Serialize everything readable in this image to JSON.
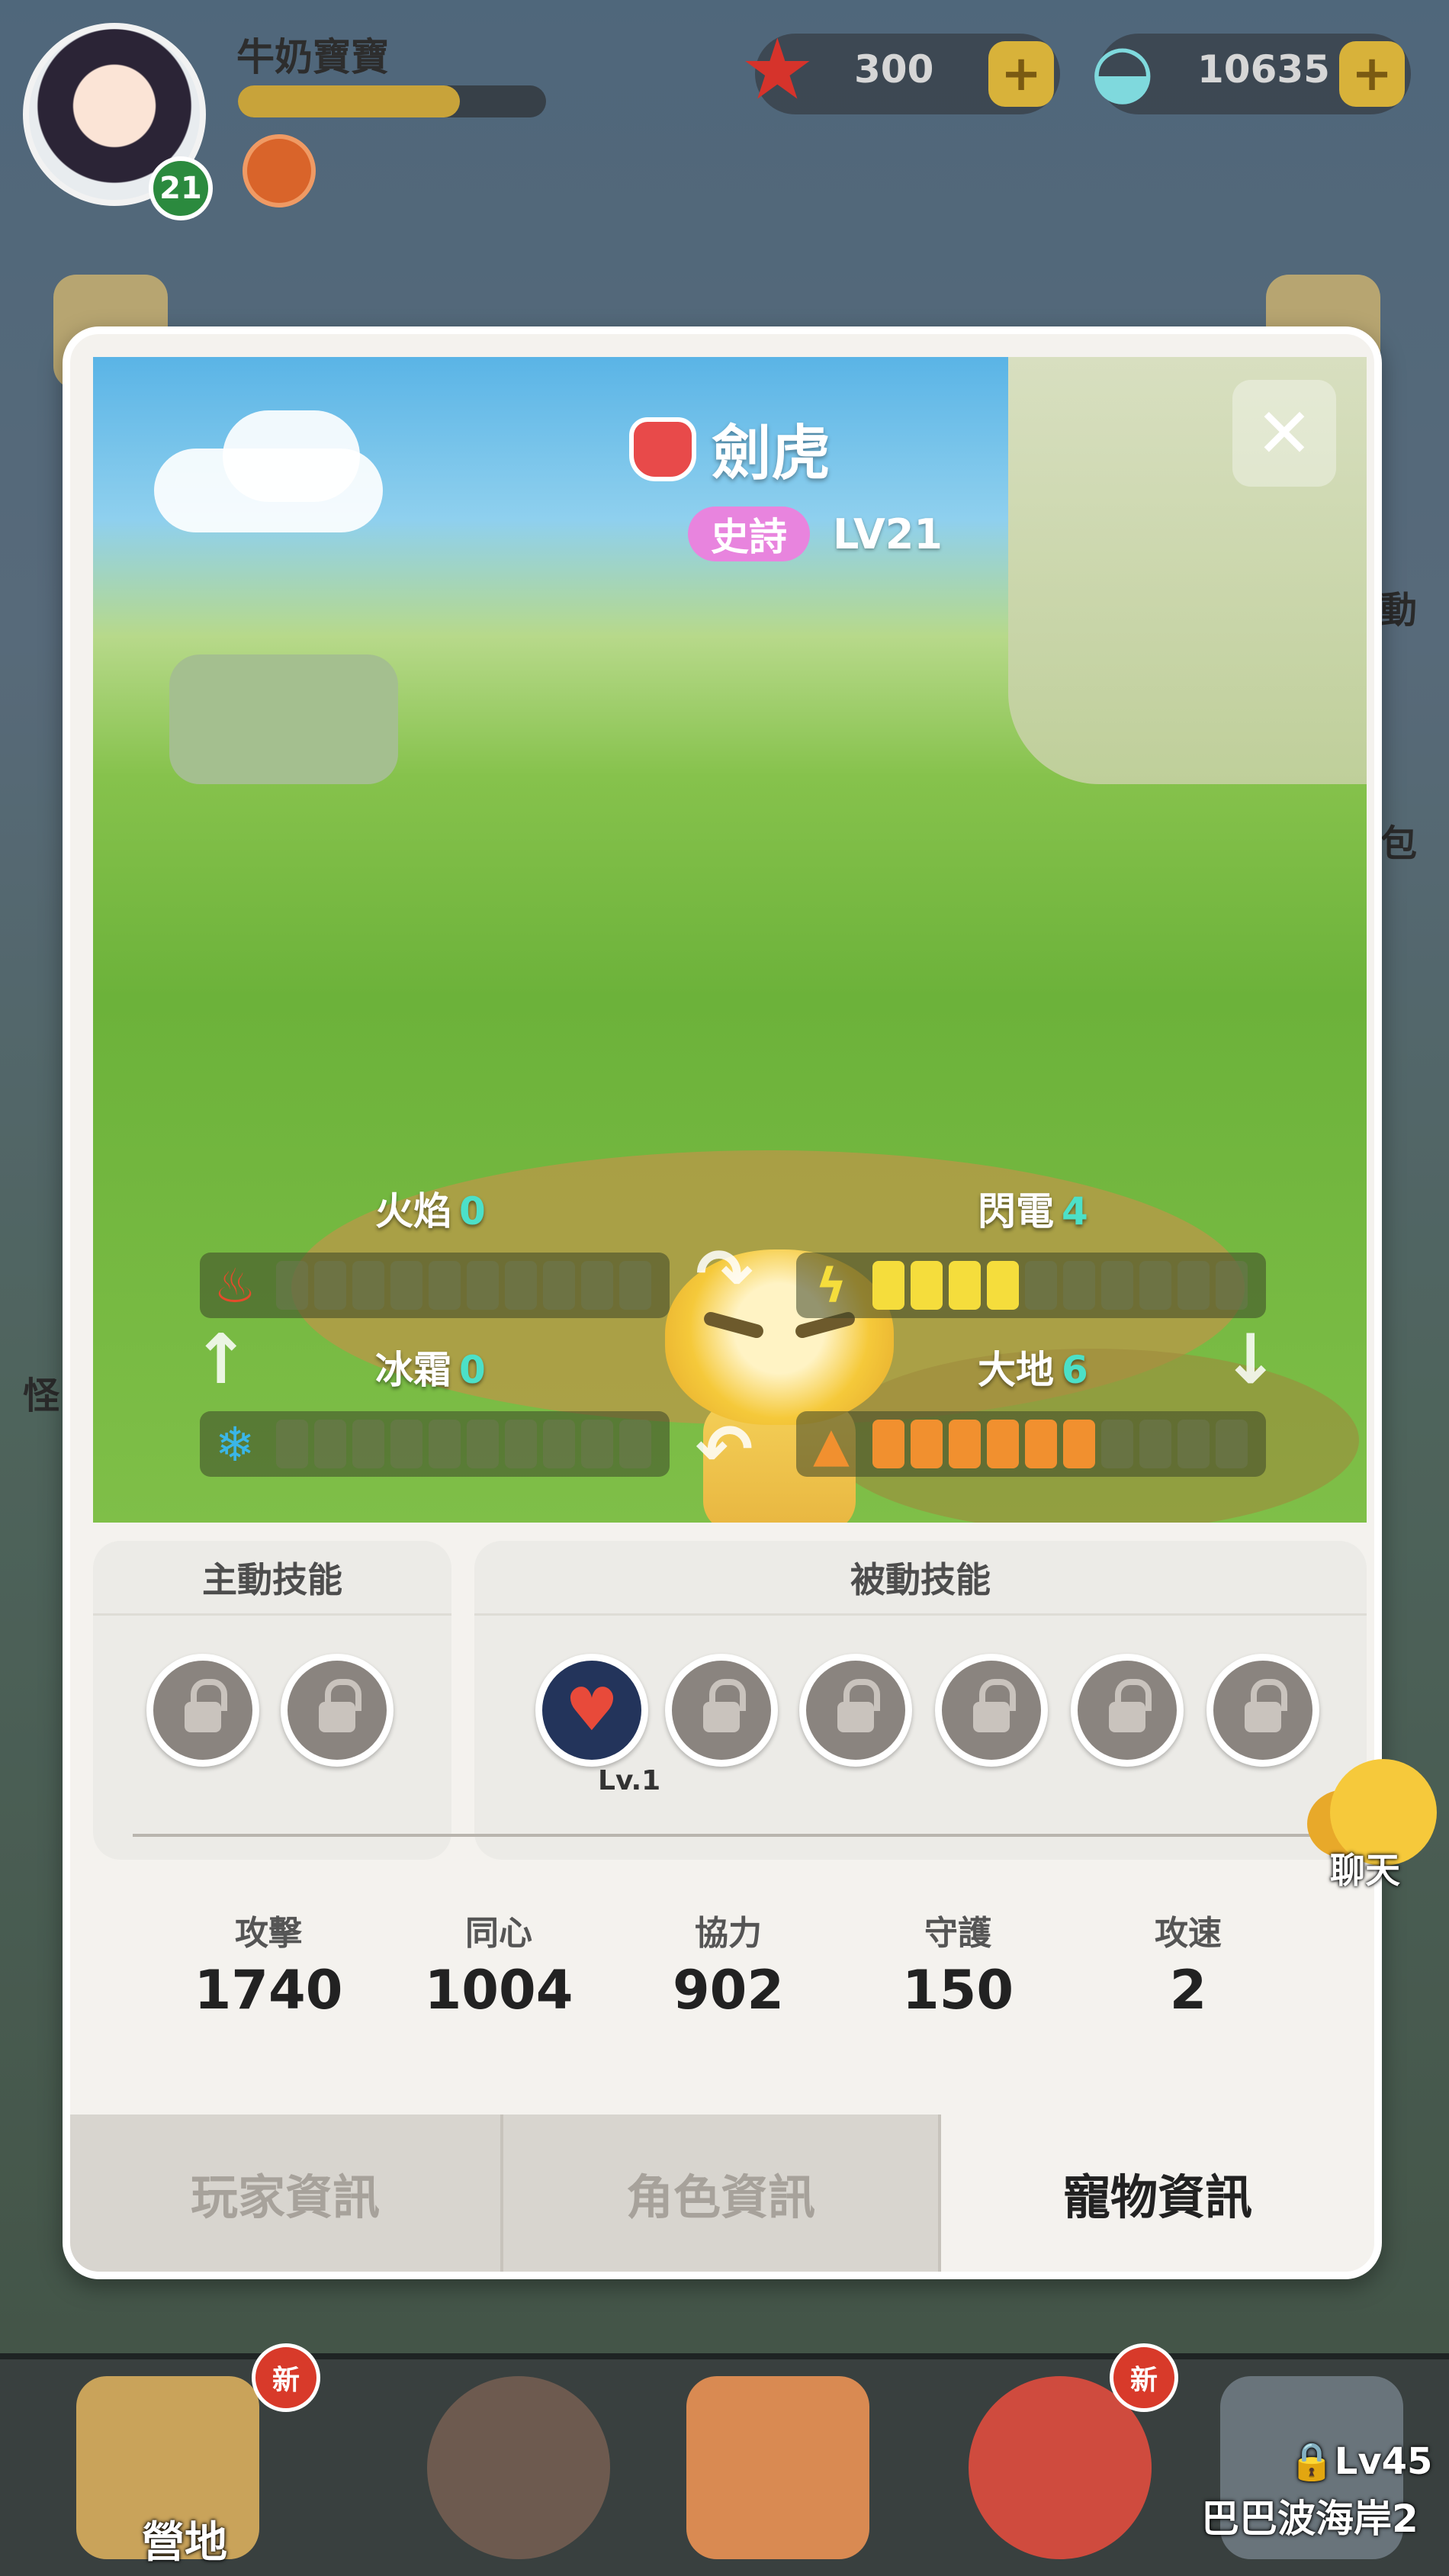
{
  "player": {
    "name": "牛奶寶寶",
    "level": "21",
    "xp_fraction": 0.72
  },
  "resources": {
    "starfish": "300",
    "shells": "10635",
    "plus": "+"
  },
  "side": {
    "right_1": "動",
    "right_2": "包",
    "left_1": "怪"
  },
  "pet": {
    "name": "劍虎",
    "rarity": "史詩",
    "level": "LV21",
    "close": "✕"
  },
  "elements": {
    "fire": {
      "label": "火焰",
      "value": "0",
      "filled": 0,
      "color": "#e54b2b"
    },
    "lightning": {
      "label": "閃電",
      "value": "4",
      "filled": 4,
      "color": "#f5dd3c"
    },
    "frost": {
      "label": "冰霜",
      "value": "0",
      "filled": 0,
      "color": "#3ab6e8"
    },
    "earth": {
      "label": "大地",
      "value": "6",
      "filled": 6,
      "color": "#f1902f"
    },
    "max_segments": 10
  },
  "skills": {
    "active_title": "主動技能",
    "passive_title": "被動技能",
    "passive_level": "Lv.1"
  },
  "stats": [
    {
      "label": "攻擊",
      "value": "1740"
    },
    {
      "label": "同心",
      "value": "1004"
    },
    {
      "label": "協力",
      "value": "902"
    },
    {
      "label": "守護",
      "value": "150"
    },
    {
      "label": "攻速",
      "value": "2"
    }
  ],
  "tabs": {
    "player": "玩家資訊",
    "character": "角色資訊",
    "pet": "寵物資訊"
  },
  "chat": {
    "label": "聊天"
  },
  "bottom": {
    "camp": "營地",
    "new1": "新",
    "new2": "新",
    "lock_level": "Lv45",
    "area": "巴巴波海岸2"
  }
}
